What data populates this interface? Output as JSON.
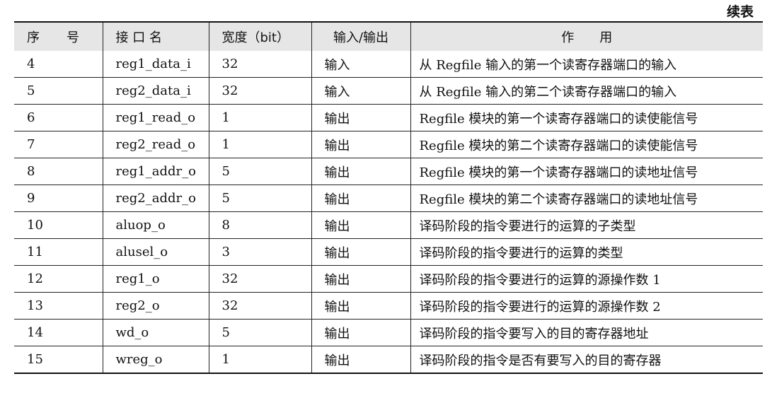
{
  "caption": "续表",
  "headers": {
    "seq_a": "序",
    "seq_b": "号",
    "name": "接 口 名",
    "width": "宽度（bit）",
    "io": "输入/输出",
    "desc": "作　　用"
  },
  "rows": [
    {
      "seq": "4",
      "name": "reg1_data_i",
      "width": "32",
      "io": "输入",
      "desc": "从 Regfile 输入的第一个读寄存器端口的输入"
    },
    {
      "seq": "5",
      "name": "reg2_data_i",
      "width": "32",
      "io": "输入",
      "desc": "从 Regfile 输入的第二个读寄存器端口的输入"
    },
    {
      "seq": "6",
      "name": "reg1_read_o",
      "width": "1",
      "io": "输出",
      "desc": "Regfile 模块的第一个读寄存器端口的读使能信号"
    },
    {
      "seq": "7",
      "name": "reg2_read_o",
      "width": "1",
      "io": "输出",
      "desc": "Regfile 模块的第二个读寄存器端口的读使能信号"
    },
    {
      "seq": "8",
      "name": "reg1_addr_o",
      "width": "5",
      "io": "输出",
      "desc": "Regfile 模块的第一个读寄存器端口的读地址信号"
    },
    {
      "seq": "9",
      "name": "reg2_addr_o",
      "width": "5",
      "io": "输出",
      "desc": "Regfile 模块的第二个读寄存器端口的读地址信号"
    },
    {
      "seq": "10",
      "name": "aluop_o",
      "width": "8",
      "io": "输出",
      "desc": "译码阶段的指令要进行的运算的子类型"
    },
    {
      "seq": "11",
      "name": "alusel_o",
      "width": "3",
      "io": "输出",
      "desc": "译码阶段的指令要进行的运算的类型"
    },
    {
      "seq": "12",
      "name": "reg1_o",
      "width": "32",
      "io": "输出",
      "desc": "译码阶段的指令要进行的运算的源操作数 1"
    },
    {
      "seq": "13",
      "name": "reg2_o",
      "width": "32",
      "io": "输出",
      "desc": "译码阶段的指令要进行的运算的源操作数 2"
    },
    {
      "seq": "14",
      "name": "wd_o",
      "width": "5",
      "io": "输出",
      "desc": "译码阶段的指令要写入的目的寄存器地址"
    },
    {
      "seq": "15",
      "name": "wreg_o",
      "width": "1",
      "io": "输出",
      "desc": "译码阶段的指令是否有要写入的目的寄存器"
    }
  ]
}
